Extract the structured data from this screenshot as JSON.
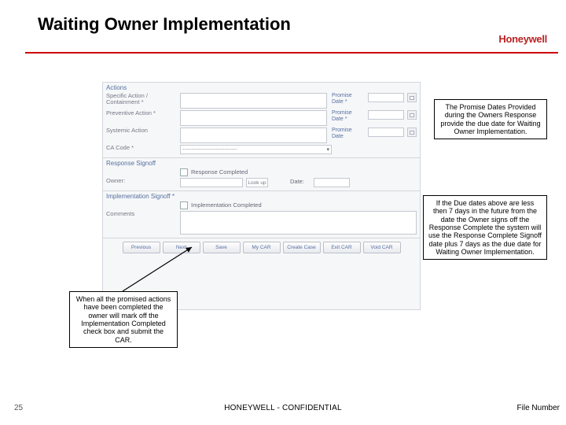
{
  "title": "Waiting Owner Implementation",
  "brand": "Honeywell",
  "form": {
    "actions_label": "Actions",
    "rows": [
      {
        "label": "Specific Action / Containment *",
        "date_label": "Promise\nDate *"
      },
      {
        "label": "Preventive Action *",
        "date_label": "Promise\nDate *"
      },
      {
        "label": "Systemic Action",
        "date_label": "Promise\nDate"
      }
    ],
    "ca_code_label": "CA Code *",
    "ca_code_value": "------------------------------",
    "response_signoff_label": "Response Signoff",
    "response_completed_label": "Response Completed",
    "owner_label": "Owner:",
    "lookup_label": "Look up",
    "date_label": "Date:",
    "impl_signoff_label": "Implementation Signoff *",
    "impl_completed_label": "Implementation Completed",
    "comments_label": "Comments"
  },
  "buttons": [
    "Previous",
    "Next",
    "Save",
    "My CAR",
    "Create Case",
    "Exit CAR",
    "Void CAR"
  ],
  "callouts": {
    "top": "The Promise Dates Provided during the Owners Response provide the due date for Waiting Owner Implementation.",
    "right": "If the Due dates above are less then 7 days in the future from the date the Owner signs off the Response Complete the system will use the Response Complete Signoff date plus 7 days as the due date for Waiting Owner Implementation.",
    "left": "When all the promised actions have been completed the owner will mark off the Implementation Completed check box and submit the CAR."
  },
  "footer": {
    "page": "25",
    "center": "HONEYWELL - CONFIDENTIAL",
    "right": "File Number"
  }
}
